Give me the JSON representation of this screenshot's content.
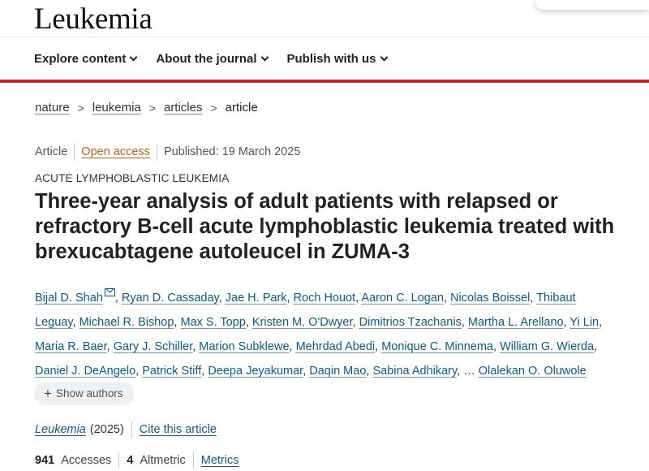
{
  "header": {
    "logo": "Leukemia",
    "nav": [
      "Explore content",
      "About the journal",
      "Publish with us"
    ]
  },
  "breadcrumb": {
    "items": [
      "nature",
      "leukemia",
      "articles"
    ],
    "current": "article",
    "separator": ">"
  },
  "article": {
    "type": "Article",
    "access": "Open access",
    "published": "Published: 19 March 2025",
    "subject": "ACUTE LYMPHOBLASTIC LEUKEMIA",
    "title": "Three-year analysis of adult patients with relapsed or refractory B-cell acute lymphoblastic leukemia treated with brexucabtagene autoleucel in ZUMA-3",
    "authors": [
      "Bijal D. Shah",
      "Ryan D. Cassaday",
      "Jae H. Park",
      "Roch Houot",
      "Aaron C. Logan",
      "Nicolas Boissel",
      "Thibaut Leguay",
      "Michael R. Bishop",
      "Max S. Topp",
      "Kristen M. O'Dwyer",
      "Dimitrios Tzachanis",
      "Martha L. Arellano",
      "Yi Lin",
      "Maria R. Baer",
      "Gary J. Schiller",
      "Marion Subklewe",
      "Mehrdad Abedi",
      "Monique C. Minnema",
      "William G. Wierda",
      "Daniel J. DeAngelo",
      "Patrick Stiff",
      "Deepa Jeyakumar",
      "Daqin Mao",
      "Sabina Adhikary",
      "Olalekan O. Oluwole"
    ],
    "authors_ellipsis": "…",
    "show_authors": "Show authors",
    "journal": "Leukemia",
    "year": "(2025)",
    "cite": "Cite this article",
    "accesses_count": "941",
    "accesses_label": "Accesses",
    "altmetric_count": "4",
    "altmetric_label": "Altmetric",
    "metrics_link": "Metrics"
  },
  "colors": {
    "accent_red": "#c0262c",
    "link_blue": "#0b5a8a",
    "open_access": "#b5651d"
  },
  "icons": {
    "corresponding_author": "mail-icon",
    "show_authors": "plus-icon",
    "nav_dropdown": "chevron-down-icon"
  }
}
